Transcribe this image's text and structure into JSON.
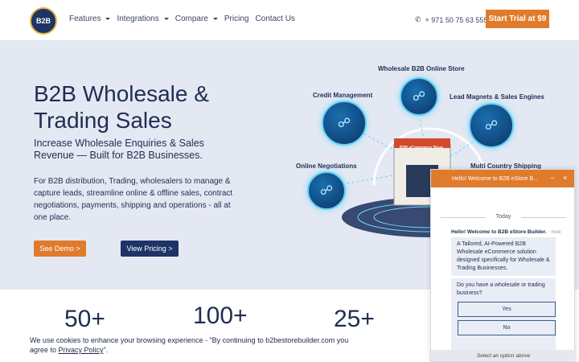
{
  "header": {
    "logo_text": "B2B",
    "nav": [
      "Features",
      "Integrations",
      "Compare",
      "Pricing",
      "Contact Us"
    ],
    "phone": "+ 971 50 75 63 555",
    "cta": "Start Trial at $9"
  },
  "hero": {
    "title": "B2B Wholesale & Trading Sales",
    "subtitle": "Increase Wholesale Enquiries & Sales Revenue — Built for B2B Businesses.",
    "description": "For B2B distribution, Trading, wholesalers to manage & capture leads, streamline online & offline sales, contract negotiations, payments, shipping and operations - all at one place.",
    "demo_button": "See Demo >",
    "pricing_button": "View Pricing >"
  },
  "illustration": {
    "labels": {
      "online_store": "Wholesale B2B Online Store",
      "credit": "Credit Management",
      "lead_magnets": "Lead Magnets & Sales Engines",
      "negotiations": "Online Negotiations",
      "shipping": "Multi Country Shipping",
      "store_sign": "B2B eCommerce Store"
    }
  },
  "stats": [
    "50+",
    "100+",
    "25+"
  ],
  "cookie": {
    "text_pre": "We use cookies to enhance your browsing experience - \"By continuing to b2bestorebuilder.com you agree to ",
    "link": "Privacy Policy",
    "text_post": "\"."
  },
  "chat": {
    "header": "Hello! Welcome to B2B eStore B...",
    "minimize": "−",
    "close": "×",
    "day": "Today",
    "sender": "Hello! Welcome to B2B eStore Builder.",
    "time": " · now",
    "message1": "A Tailored, AI-Powered B2B Wholesale eCommerce solution designed specifically for Wholesale & Trading Businesses.",
    "message2": "Do you have a wholesale or trading business?",
    "options": [
      "Yes",
      "No"
    ],
    "footer": "Select an option above"
  },
  "colors": {
    "accent": "#e07b2c",
    "navy": "#1f3466",
    "hero_bg": "#e4e8f2"
  }
}
